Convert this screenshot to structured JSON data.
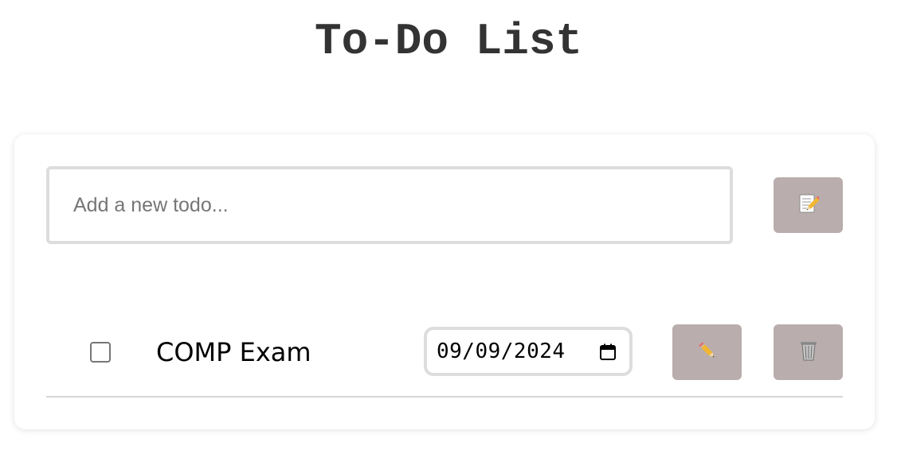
{
  "header": {
    "title": "To-Do List"
  },
  "new_todo": {
    "placeholder": "Add a new todo...",
    "value": "",
    "add_icon": "memo-pencil-icon"
  },
  "todos": [
    {
      "text": "COMP Exam",
      "completed": false,
      "due_date": "09/09/2024",
      "edit_icon": "pencil-icon",
      "delete_icon": "trash-can-icon"
    }
  ],
  "colors": {
    "button_bg": "#b9adad",
    "title": "#333333",
    "input_border": "#dddddd"
  }
}
